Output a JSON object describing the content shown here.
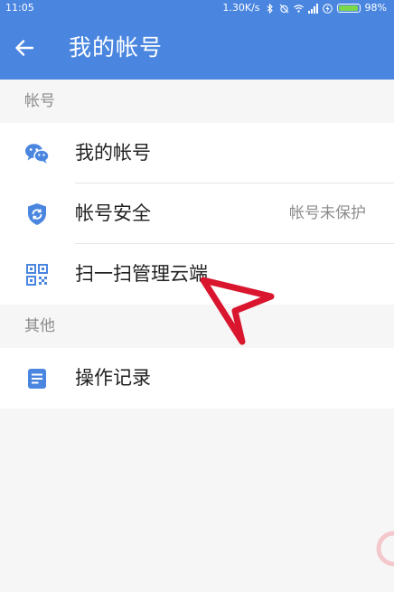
{
  "status_bar": {
    "time": "11:05",
    "speed": "1.30K/s",
    "battery": "98%",
    "battery_level": 0.98
  },
  "app_bar": {
    "title": "我的帐号",
    "back_icon": "arrow-left-icon"
  },
  "sections": [
    {
      "header": "帐号",
      "items": [
        {
          "label": "我的帐号",
          "icon": "wechat-icon",
          "value": ""
        },
        {
          "label": "帐号安全",
          "icon": "shield-icon",
          "value": "帐号未保护"
        },
        {
          "label": "扫一扫管理云端",
          "icon": "qr-code-icon",
          "value": ""
        }
      ]
    },
    {
      "header": "其他",
      "items": [
        {
          "label": "操作记录",
          "icon": "document-icon",
          "value": ""
        }
      ]
    }
  ],
  "colors": {
    "primary": "#4a86e0",
    "icon": "#4a86e0",
    "annotation": "#d9162e",
    "background": "#f6f6f6"
  }
}
